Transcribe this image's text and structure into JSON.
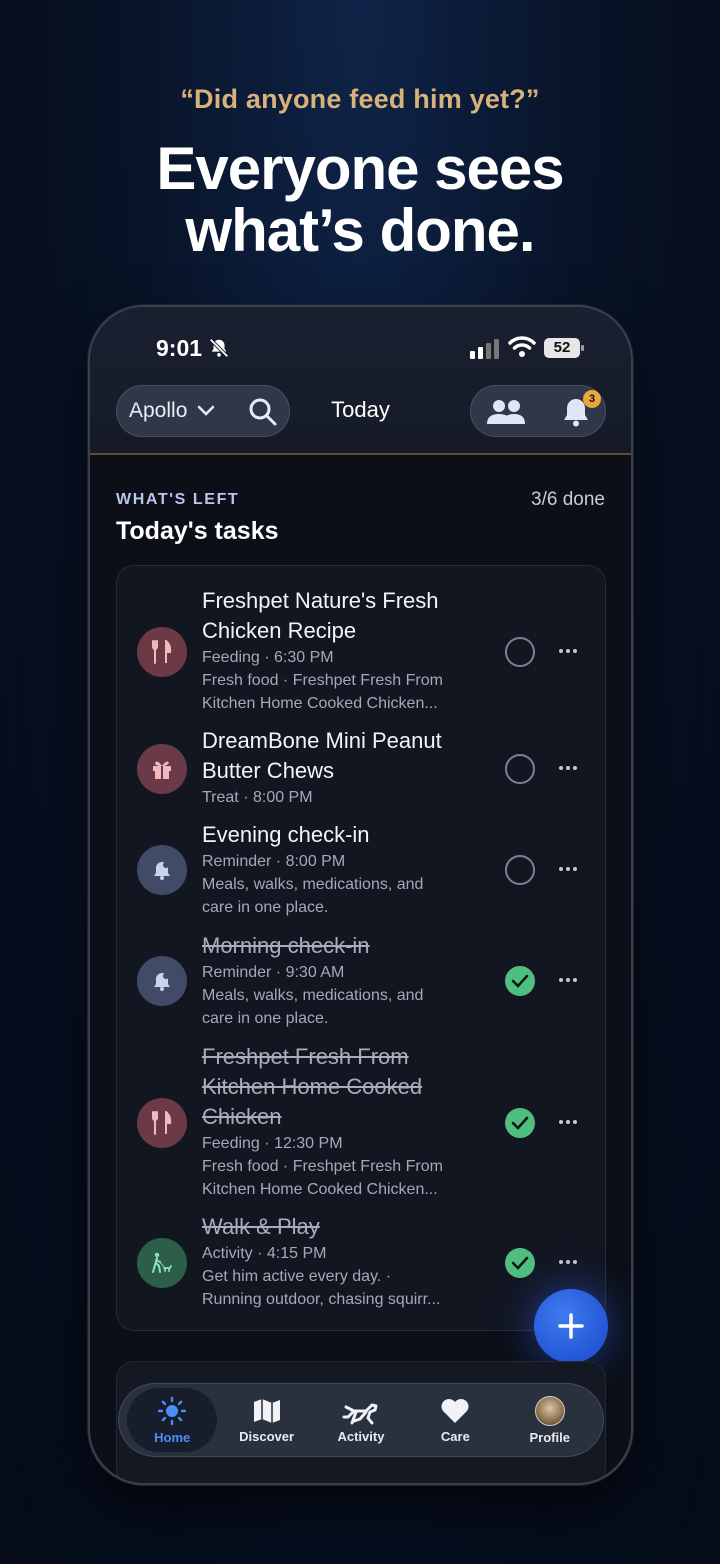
{
  "header": {
    "quote": "“Did anyone feed him yet?”",
    "headline_line1": "Everyone sees",
    "headline_line2": "what’s done."
  },
  "status_bar": {
    "time": "9:01",
    "battery": "52"
  },
  "nav": {
    "pet_name": "Apollo",
    "title": "Today",
    "notification_count": "3"
  },
  "section": {
    "kicker": "WHAT'S LEFT",
    "title": "Today's tasks",
    "progress": "3/6 done"
  },
  "tasks": [
    {
      "title_line1": "Freshpet Nature's Fresh",
      "title_line2": "Chicken Recipe",
      "meta": "Feeding · 6:30 PM",
      "desc_line1": "Fresh food · Freshpet Fresh From",
      "desc_line2": "Kitchen Home Cooked Chicken...",
      "done": false,
      "icon": "fork-knife-icon",
      "color": "#6b3a44"
    },
    {
      "title_line1": "DreamBone Mini Peanut",
      "title_line2": "Butter Chews",
      "meta": "Treat · 8:00 PM",
      "desc_line1": "",
      "desc_line2": "",
      "done": false,
      "icon": "gift-icon",
      "color": "#6b3a48"
    },
    {
      "title_line1": "Evening check-in",
      "title_line2": "",
      "meta": "Reminder · 8:00 PM",
      "desc_line1": "Meals, walks, medications, and",
      "desc_line2": "care in one place.",
      "done": false,
      "icon": "bell-icon",
      "color": "#414a66"
    },
    {
      "title_line1": "Morning check-in",
      "title_line2": "",
      "meta": "Reminder · 9:30 AM",
      "desc_line1": "Meals, walks, medications, and",
      "desc_line2": "care in one place.",
      "done": true,
      "icon": "bell-icon",
      "color": "#414a66"
    },
    {
      "title_line1": "Freshpet Fresh From",
      "title_line2": "Kitchen Home Cooked",
      "title_line3": "Chicken",
      "meta": "Feeding · 12:30 PM",
      "desc_line1": "Fresh food · Freshpet Fresh From",
      "desc_line2": "Kitchen Home Cooked Chicken...",
      "done": true,
      "icon": "fork-knife-icon",
      "color": "#6b3a44"
    },
    {
      "title_line1": "Walk & Play",
      "title_line2": "",
      "meta": "Activity · 4:15 PM",
      "desc_line1": "Get him active every day. ·",
      "desc_line2": "Running outdoor, chasing squirr...",
      "done": true,
      "icon": "walking-dog-icon",
      "color": "#2c5e48"
    }
  ],
  "tabbar": {
    "home": "Home",
    "discover": "Discover",
    "activity": "Activity",
    "care": "Care",
    "profile": "Profile"
  },
  "colors": {
    "accent_blue": "#2457d6",
    "check_green": "#4fbf80",
    "quote_gold": "#d8b27a"
  }
}
